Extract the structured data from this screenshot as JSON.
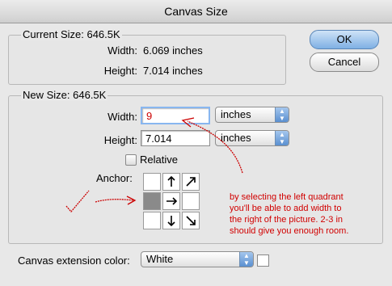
{
  "window": {
    "title": "Canvas Size"
  },
  "current": {
    "title": "Current Size: 646.5K",
    "width_label": "Width:",
    "width_value": "6.069 inches",
    "height_label": "Height:",
    "height_value": "7.014 inches"
  },
  "new_size": {
    "title": "New Size: 646.5K",
    "width_label": "Width:",
    "width_value": "9",
    "width_unit": "inches",
    "height_label": "Height:",
    "height_value": "7.014",
    "height_unit": "inches",
    "relative_label": "Relative",
    "anchor_label": "Anchor:"
  },
  "buttons": {
    "ok": "OK",
    "cancel": "Cancel"
  },
  "extension": {
    "label": "Canvas extension color:",
    "value": "White"
  },
  "annotation": {
    "line1": "by selecting the left quadrant",
    "line2": "you'll be able to add width to",
    "line3": "the right of the picture.  2-3 in",
    "line4": "should give you enough room."
  },
  "colors": {
    "annotation": "#d10000",
    "focus": "#88b6f0"
  }
}
